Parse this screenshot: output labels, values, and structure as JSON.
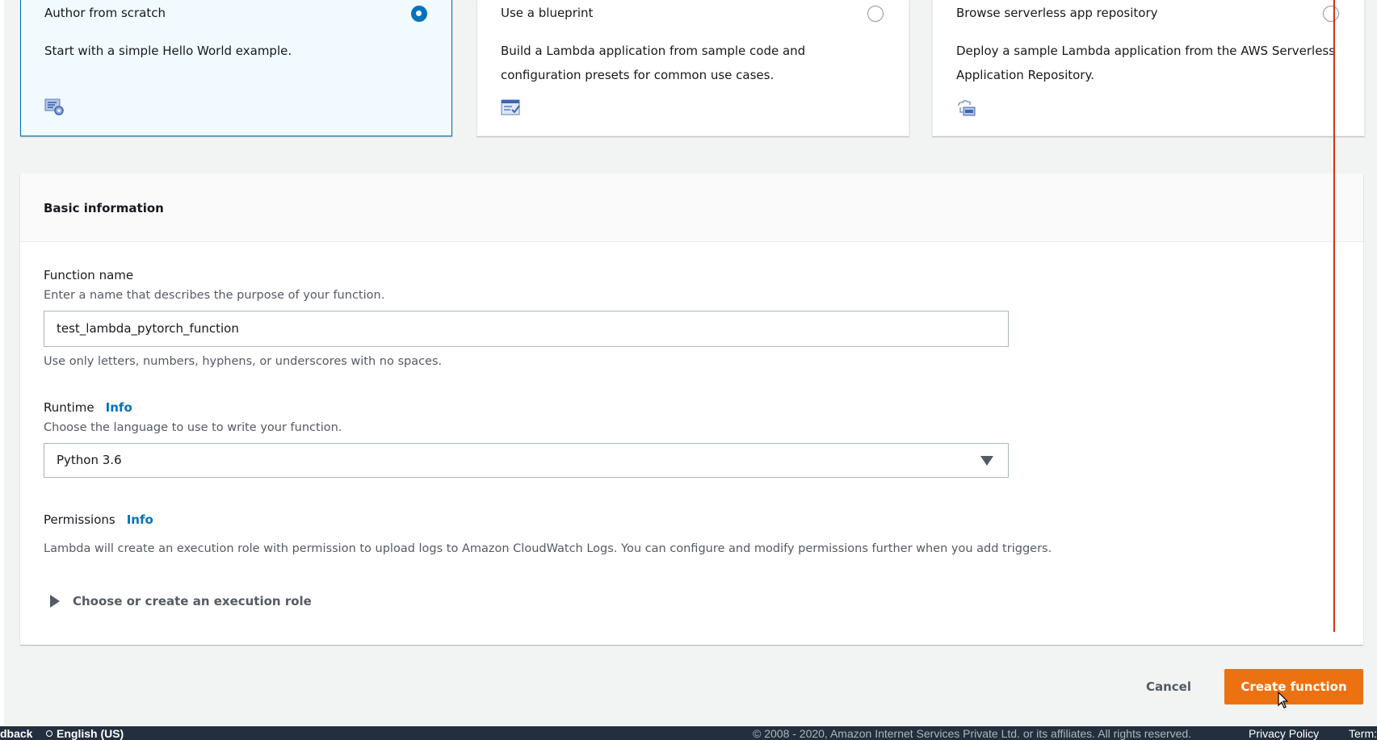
{
  "options": [
    {
      "title": "Author from scratch",
      "description": "Start with a simple Hello World example.",
      "selected": true,
      "icon": "code-gear-icon"
    },
    {
      "title": "Use a blueprint",
      "description": "Build a Lambda application from sample code and configuration presets for common use cases.",
      "selected": false,
      "icon": "blueprint-list-icon"
    },
    {
      "title": "Browse serverless app repository",
      "description": "Deploy a sample Lambda application from the AWS Serverless Application Repository.",
      "selected": false,
      "icon": "cloud-repository-icon"
    }
  ],
  "basic_info": {
    "title": "Basic information",
    "function_name": {
      "label": "Function name",
      "description": "Enter a name that describes the purpose of your function.",
      "value": "test_lambda_pytorch_function",
      "hint": "Use only letters, numbers, hyphens, or underscores with no spaces."
    },
    "runtime": {
      "label": "Runtime",
      "info": "Info",
      "description": "Choose the language to use to write your function.",
      "selected": "Python 3.6"
    },
    "permissions": {
      "label": "Permissions",
      "info": "Info",
      "description": "Lambda will create an execution role with permission to upload logs to Amazon CloudWatch Logs. You can configure and modify permissions further when you add triggers.",
      "expander": "Choose or create an execution role"
    }
  },
  "actions": {
    "cancel": "Cancel",
    "create": "Create function"
  },
  "footer": {
    "feedback": "dback",
    "language": "English (US)",
    "copyright": "© 2008 - 2020, Amazon Internet Services Private Ltd. or its affiliates. All rights reserved.",
    "privacy": "Privacy Policy",
    "terms": "Term:"
  },
  "colors": {
    "accent": "#0073bb",
    "primary_button": "#ec7211",
    "footer_bg": "#232f3e",
    "marker_line": "#d13212"
  }
}
